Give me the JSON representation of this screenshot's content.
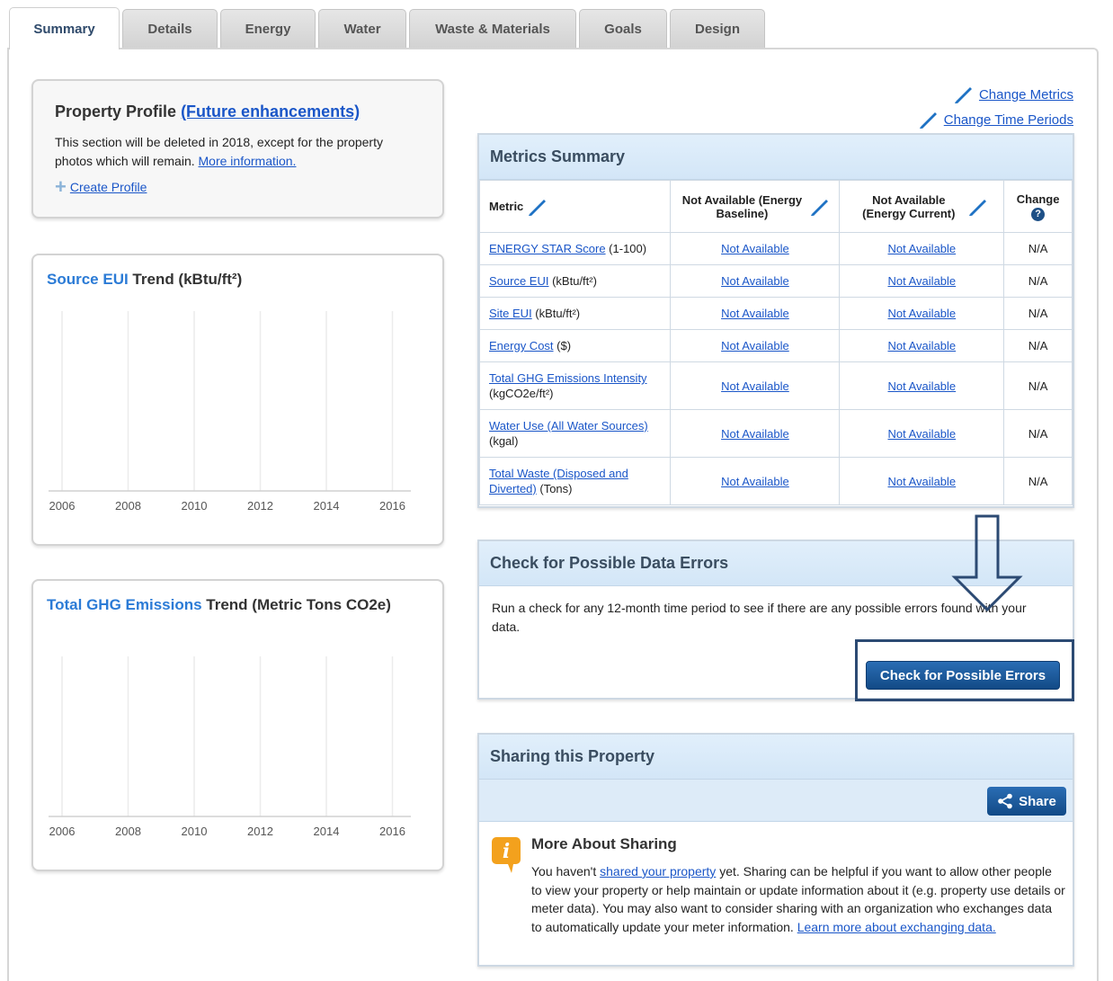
{
  "tabs": [
    "Summary",
    "Details",
    "Energy",
    "Water",
    "Waste & Materials",
    "Goals",
    "Design"
  ],
  "profile": {
    "title": "Property Profile",
    "link": "(Future enhancements)",
    "desc": "This section will be deleted in 2018, except for the property photos which will remain.",
    "more_link": "More information.",
    "create_link": "Create Profile"
  },
  "chart1": {
    "title_hl": "Source EUI",
    "title_rest": " Trend (kBtu/ft²)"
  },
  "chart2": {
    "title_hl": "Total GHG Emissions",
    "title_rest": " Trend (Metric Tons CO2e)"
  },
  "chart_data": [
    {
      "type": "line",
      "title": "Source EUI Trend (kBtu/ft²)",
      "x": [
        "2006",
        "2008",
        "2010",
        "2012",
        "2014",
        "2016"
      ],
      "series": [],
      "grid": true
    },
    {
      "type": "line",
      "title": "Total GHG Emissions Trend (Metric Tons CO2e)",
      "x": [
        "2006",
        "2008",
        "2010",
        "2012",
        "2014",
        "2016"
      ],
      "series": [],
      "grid": true
    }
  ],
  "edit_links": {
    "change_metrics": "Change Metrics",
    "change_periods": "Change Time Periods"
  },
  "metrics": {
    "title": "Metrics Summary",
    "headers": {
      "metric": "Metric",
      "baseline": "Not Available (Energy Baseline)",
      "current": "Not Available (Energy Current)",
      "change": "Change"
    },
    "rows": [
      {
        "link": "ENERGY STAR Score",
        "unit": " (1-100)",
        "baseline": "Not Available",
        "current": "Not Available",
        "change": "N/A"
      },
      {
        "link": "Source EUI",
        "unit": " (kBtu/ft²)",
        "baseline": "Not Available",
        "current": "Not Available",
        "change": "N/A"
      },
      {
        "link": "Site EUI",
        "unit": " (kBtu/ft²)",
        "baseline": "Not Available",
        "current": "Not Available",
        "change": "N/A"
      },
      {
        "link": "Energy Cost",
        "unit": " ($)",
        "baseline": "Not Available",
        "current": "Not Available",
        "change": "N/A"
      },
      {
        "link": "Total GHG Emissions Intensity",
        "unit": " (kgCO2e/ft²)",
        "baseline": "Not Available",
        "current": "Not Available",
        "change": "N/A"
      },
      {
        "link": "Water Use (All Water Sources)",
        "unit": " (kgal)",
        "baseline": "Not Available",
        "current": "Not Available",
        "change": "N/A"
      },
      {
        "link": "Total Waste (Disposed and Diverted)",
        "unit": " (Tons)",
        "baseline": "Not Available",
        "current": "Not Available",
        "change": "N/A"
      }
    ]
  },
  "errors": {
    "title": "Check for Possible Data Errors",
    "body": "Run a check for any 12-month time period to see if there are any possible errors found with your data.",
    "button": "Check for Possible Errors"
  },
  "sharing": {
    "title": "Sharing this Property",
    "share_button": "Share",
    "more_title": "More About Sharing",
    "body_pre": "You haven't ",
    "body_link": "shared your property",
    "body_mid": " yet. Sharing can be helpful if you want to allow other people to view your property or help maintain or update information about it (e.g. property use details or meter data). You may also want to consider sharing with an organization who exchanges data to automatically update your meter information. ",
    "body_link2": "Learn more about exchanging data."
  }
}
